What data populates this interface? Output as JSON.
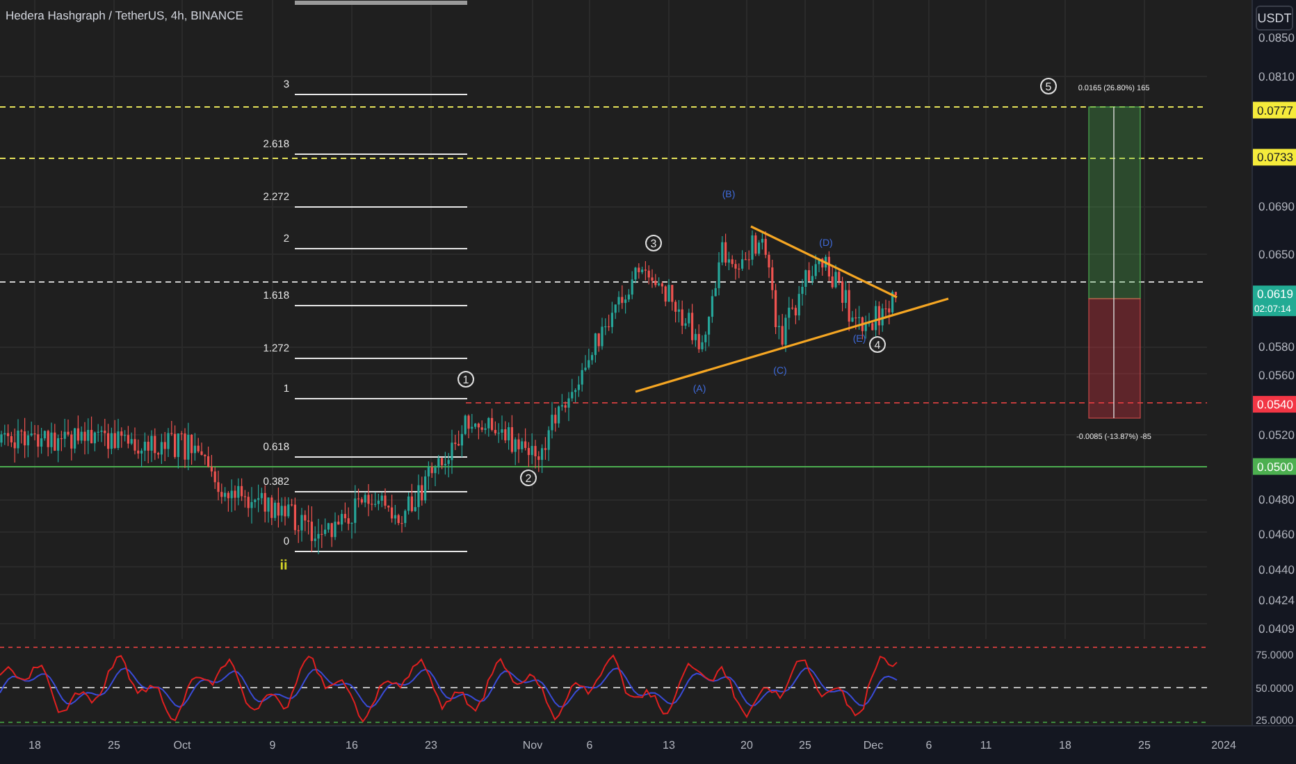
{
  "header": {
    "title": "Hedera Hashgraph / TetherUS, 4h, BINANCE"
  },
  "currency_button": {
    "label": "USDT"
  },
  "price_axis": [
    {
      "label": "0.0850",
      "kind": "plain"
    },
    {
      "label": "0.0810",
      "kind": "plain"
    },
    {
      "label": "0.0777",
      "kind": "badge",
      "color": "#f5eb3b"
    },
    {
      "label": "0.0733",
      "kind": "badge",
      "color": "#f5eb3b"
    },
    {
      "label": "0.0690",
      "kind": "plain"
    },
    {
      "label": "0.0650",
      "kind": "plain"
    },
    {
      "label": "0.0619",
      "kind": "badge",
      "color": "#22ab94",
      "countdown": "02:07:14"
    },
    {
      "label": "0.0580",
      "kind": "plain"
    },
    {
      "label": "0.0560",
      "kind": "plain"
    },
    {
      "label": "0.0540",
      "kind": "badge",
      "color": "#f23645"
    },
    {
      "label": "0.0520",
      "kind": "plain"
    },
    {
      "label": "0.0500",
      "kind": "badge",
      "color": "#4caf50"
    },
    {
      "label": "0.0480",
      "kind": "plain"
    },
    {
      "label": "0.0460",
      "kind": "plain"
    },
    {
      "label": "0.0440",
      "kind": "plain"
    },
    {
      "label": "0.0424",
      "kind": "plain"
    },
    {
      "label": "0.0409",
      "kind": "plain"
    }
  ],
  "fib_levels": [
    "3",
    "2.618",
    "2.272",
    "2",
    "1.618",
    "1.272",
    "1",
    "0.618",
    "0.382",
    "0"
  ],
  "wave_labels": [
    {
      "label": "1",
      "kind": "circled"
    },
    {
      "label": "2",
      "kind": "circled"
    },
    {
      "label": "3",
      "kind": "circled"
    },
    {
      "label": "4",
      "kind": "circled"
    },
    {
      "label": "5",
      "kind": "circled"
    },
    {
      "label": "(A)",
      "kind": "letter"
    },
    {
      "label": "(B)",
      "kind": "letter"
    },
    {
      "label": "(C)",
      "kind": "letter"
    },
    {
      "label": "(D)",
      "kind": "letter"
    },
    {
      "label": "(E)",
      "kind": "letter"
    },
    {
      "label": "ii",
      "kind": "roman"
    }
  ],
  "position": {
    "target_label": "0.0165 (26.80%) 165",
    "stop_label": "-0.0085 (-13.87%) -85"
  },
  "rsi_axis": [
    "75.0000",
    "50.0000",
    "25.0000"
  ],
  "time_axis": [
    "18",
    "25",
    "Oct",
    "9",
    "16",
    "23",
    "Nov",
    "6",
    "13",
    "20",
    "25",
    "Dec",
    "6",
    "11",
    "18",
    "25",
    "2024"
  ]
}
